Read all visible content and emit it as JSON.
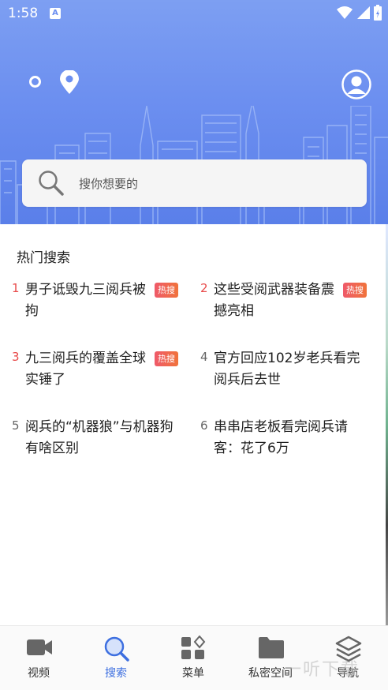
{
  "status_bar": {
    "time": "1:58",
    "notification_icon": "A",
    "icons": [
      "wifi-icon",
      "signal-icon",
      "battery-icon"
    ]
  },
  "header": {
    "icons": [
      "ring-icon",
      "location-pin-icon",
      "user-avatar-icon"
    ],
    "search": {
      "placeholder": "搜你想要的",
      "icon": "search-icon"
    }
  },
  "hot_search": {
    "title": "热门搜索",
    "items": [
      {
        "rank": "1",
        "text": "男子诋毁九三阅兵被拘",
        "badge": "热搜",
        "rank_color": "#e84a4a"
      },
      {
        "rank": "2",
        "text": "这些受阅武器装备震撼亮相",
        "badge": "热搜",
        "rank_color": "#e84a4a"
      },
      {
        "rank": "3",
        "text": "九三阅兵的覆盖全球实锤了",
        "badge": "热搜",
        "rank_color": "#e84a4a"
      },
      {
        "rank": "4",
        "text": "官方回应102岁老兵看完阅兵后去世",
        "badge": "",
        "rank_color": "#666666"
      },
      {
        "rank": "5",
        "text": "阅兵的“机器狼”与机器狗有啥区别",
        "badge": "",
        "rank_color": "#666666"
      },
      {
        "rank": "6",
        "text": "串串店老板看完阅兵请客：花了6万",
        "badge": "",
        "rank_color": "#666666"
      }
    ]
  },
  "bottom_nav": {
    "items": [
      {
        "label": "视频",
        "icon": "video-camera-icon",
        "active": false
      },
      {
        "label": "搜索",
        "icon": "search-icon",
        "active": true
      },
      {
        "label": "菜单",
        "icon": "grid-menu-icon",
        "active": false
      },
      {
        "label": "私密空间",
        "icon": "folder-icon",
        "active": false
      },
      {
        "label": "导航",
        "icon": "layers-icon",
        "active": false
      }
    ]
  },
  "watermark": "一听下载",
  "colors": {
    "header_top": "#7d9ff2",
    "header_bottom": "#5a7fe9",
    "active_tab": "#3d6fe0",
    "hot_badge": "#ef5a6a",
    "rank_top": "#e84a4a"
  }
}
